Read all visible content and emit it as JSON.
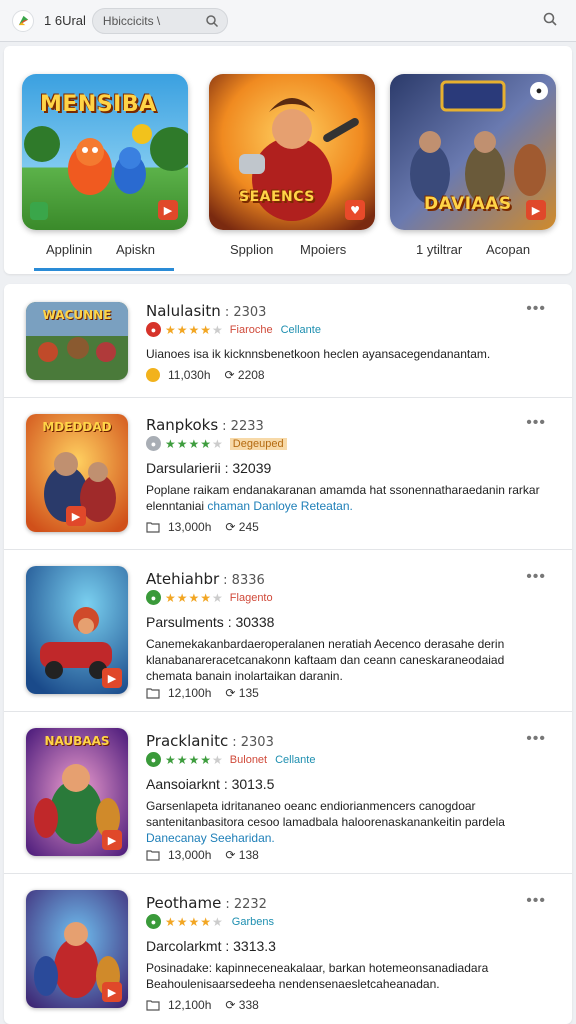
{
  "topbar": {
    "app_title": "1 6Ural",
    "search_text": "Hbiccicits \\",
    "logo_icon": "colorful-leaf-logo",
    "search_icon": "search-icon"
  },
  "featured": {
    "cards": [
      {
        "title": "MENSIBA",
        "colors": [
          "#3aa0e0",
          "#4fb34a"
        ]
      },
      {
        "title": "SEAENCS",
        "colors": [
          "#f0a020",
          "#b02020"
        ]
      },
      {
        "title": "DAVIAAS",
        "colors": [
          "#2b3a6a",
          "#d08a2a"
        ]
      }
    ],
    "tabs": [
      "Applinin",
      "Apiskn",
      "Spplion",
      "Mpoiers",
      "1 ytiltrar",
      "Acopan"
    ]
  },
  "list": [
    {
      "title": "Nalulasitn",
      "num": ": 2303",
      "badge_text": "WACUNNE",
      "rating_color": "#d6332a",
      "tag1": "Fiaroche",
      "tag2": "Cellante",
      "subtitle": "",
      "desc": "Uianoes isa ik kicknnsbenetkoon heclen ayansacegendanantam.",
      "desc_hl": "",
      "size": "11,030h",
      "downloads": "2208"
    },
    {
      "title": "Ranpkoks",
      "num": ": 2233",
      "badge_text": "MDEDDAD",
      "rating_color": "#a9aeb5",
      "tag1": "Degeuped",
      "tag2": "",
      "subtitle": "Darsularierii : 32039",
      "desc": "Poplane raikam endanakaranan amamda hat ssonennatharaedanin rarkar elenntaniai",
      "desc_hl": "chaman Danloye Reteatan.",
      "size": "13,000h",
      "downloads": "245"
    },
    {
      "title": "Atehiahbr",
      "num": ": 8336",
      "badge_text": "",
      "rating_color": "#3a9a3a",
      "tag1": "Flagento",
      "tag2": "",
      "subtitle": "Parsulments : 30338",
      "desc": "Canemekakanbardaeroperalanen neratiah Aecenco derasahe derin klanabanareracetcanakonn kaftaam dan ceann caneskaraneodaiad chemata banain inolartaikan daranin.",
      "desc_hl": "",
      "size": "12,100h",
      "downloads": "135"
    },
    {
      "title": "Pracklanitc",
      "num": ": 2303",
      "badge_text": "NAUBAAS",
      "rating_color": "#3a9a3a",
      "tag1": "Bulonet",
      "tag2": "Cellante",
      "subtitle": "Aansoiarknt : 3013.5",
      "desc": "Garsenlapeta idritananeo oeanc endiorianmencers canogdoar santenitanbasitora cesoo lamadbala haloorenaskanankeitin pardela",
      "desc_hl": "Danecanay Seeharidan.",
      "size": "13,000h",
      "downloads": "138"
    },
    {
      "title": "Peothame",
      "num": ": 2232",
      "badge_text": "",
      "rating_color": "#3a9a3a",
      "tag1": "",
      "tag2": "Garbens",
      "subtitle": "Darcolarkmt : 3313.3",
      "desc": "Posinadake: kapinneceneakalaar, barkan hotemeonsanadiadara Beahoulenisaarsedeeha nendensenaesletcaheanadan.",
      "desc_hl": "",
      "size": "12,100h",
      "downloads": "338"
    }
  ]
}
